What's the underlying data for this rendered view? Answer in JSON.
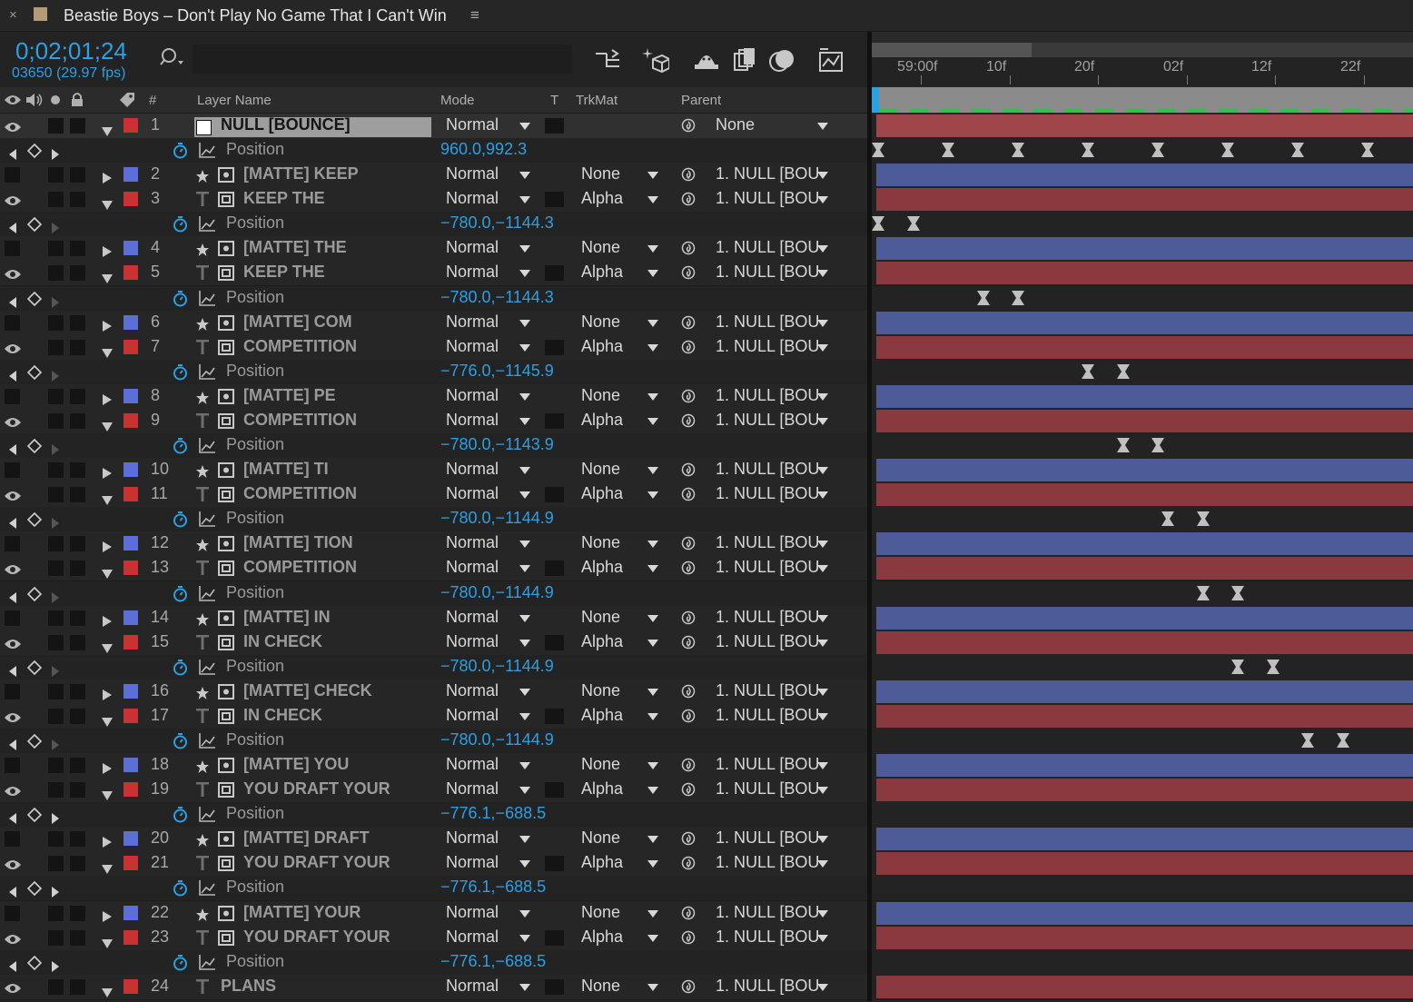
{
  "window": {
    "title": "Beastie Boys – Don't Play No Game That I Can't Win",
    "menu_icon": "≡",
    "close_icon": "×"
  },
  "toolbar": {
    "timecode": "0;02;01;24",
    "frames": "03650 (29.97 fps)"
  },
  "columns": {
    "layer_name": "Layer Name",
    "number": "#",
    "mode": "Mode",
    "t": "T",
    "trkmat": "TrkMat",
    "parent": "Parent"
  },
  "ruler": {
    "labels": [
      "59:00f",
      "10f",
      "20f",
      "02f",
      "12f",
      "22f"
    ]
  },
  "colors": {
    "accent": "#2d9fe3",
    "red_label": "#c83232",
    "blue_label": "#5c6fd6",
    "red_bar": "#8a3a3e",
    "blue_bar": "#4e5b99",
    "null_bar": "#a0464b",
    "marker_green": "#2ec24a"
  },
  "rows": [
    {
      "kind": "layer",
      "num": "1",
      "name": "NULL [BOUNCE]",
      "type": "null",
      "label": "red",
      "mode": "Normal",
      "trkmat": "",
      "parent": "None",
      "eye": true,
      "twirl": "down",
      "selected": true
    },
    {
      "kind": "prop",
      "name": "Position",
      "value": "960.0,992.3",
      "keys": true,
      "kfs": [
        0,
        14,
        28,
        42,
        56,
        70,
        84,
        98
      ]
    },
    {
      "kind": "layer",
      "num": "2",
      "name": "[MATTE] KEEP",
      "type": "shape",
      "label": "blue",
      "mode": "Normal",
      "trkmat": "None",
      "parent": "1. NULL [BOU",
      "eye": false,
      "twirl": "right"
    },
    {
      "kind": "layer",
      "num": "3",
      "name": "KEEP THE",
      "type": "text",
      "label": "red",
      "mode": "Normal",
      "trkmat": "Alpha",
      "parent": "1. NULL [BOU",
      "eye": true,
      "twirl": "down"
    },
    {
      "kind": "prop",
      "name": "Position",
      "value": "−780.0,−1144.3",
      "keys": false,
      "kfs": [
        0,
        7
      ]
    },
    {
      "kind": "layer",
      "num": "4",
      "name": "[MATTE] THE",
      "type": "shape",
      "label": "blue",
      "mode": "Normal",
      "trkmat": "None",
      "parent": "1. NULL [BOU",
      "eye": false,
      "twirl": "right"
    },
    {
      "kind": "layer",
      "num": "5",
      "name": "KEEP THE",
      "type": "text",
      "label": "red",
      "mode": "Normal",
      "trkmat": "Alpha",
      "parent": "1. NULL [BOU",
      "eye": true,
      "twirl": "down"
    },
    {
      "kind": "prop",
      "name": "Position",
      "value": "−780.0,−1144.3",
      "keys": false,
      "kfs": [
        21,
        28
      ]
    },
    {
      "kind": "layer",
      "num": "6",
      "name": "[MATTE] COM",
      "type": "shape",
      "label": "blue",
      "mode": "Normal",
      "trkmat": "None",
      "parent": "1. NULL [BOU",
      "eye": false,
      "twirl": "right"
    },
    {
      "kind": "layer",
      "num": "7",
      "name": "COMPETITION",
      "type": "text",
      "label": "red",
      "mode": "Normal",
      "trkmat": "Alpha",
      "parent": "1. NULL [BOU",
      "eye": true,
      "twirl": "down"
    },
    {
      "kind": "prop",
      "name": "Position",
      "value": "−776.0,−1145.9",
      "keys": false,
      "kfs": [
        42,
        49
      ]
    },
    {
      "kind": "layer",
      "num": "8",
      "name": "[MATTE] PE",
      "type": "shape",
      "label": "blue",
      "mode": "Normal",
      "trkmat": "None",
      "parent": "1. NULL [BOU",
      "eye": false,
      "twirl": "right"
    },
    {
      "kind": "layer",
      "num": "9",
      "name": "COMPETITION",
      "type": "text",
      "label": "red",
      "mode": "Normal",
      "trkmat": "Alpha",
      "parent": "1. NULL [BOU",
      "eye": true,
      "twirl": "down"
    },
    {
      "kind": "prop",
      "name": "Position",
      "value": "−780.0,−1143.9",
      "keys": false,
      "kfs": [
        49,
        56
      ]
    },
    {
      "kind": "layer",
      "num": "10",
      "name": "[MATTE] TI",
      "type": "shape",
      "label": "blue",
      "mode": "Normal",
      "trkmat": "None",
      "parent": "1. NULL [BOU",
      "eye": false,
      "twirl": "right"
    },
    {
      "kind": "layer",
      "num": "11",
      "name": "COMPETITION",
      "type": "text",
      "label": "red",
      "mode": "Normal",
      "trkmat": "Alpha",
      "parent": "1. NULL [BOU",
      "eye": true,
      "twirl": "down"
    },
    {
      "kind": "prop",
      "name": "Position",
      "value": "−780.0,−1144.9",
      "keys": false,
      "kfs": [
        58,
        65
      ]
    },
    {
      "kind": "layer",
      "num": "12",
      "name": "[MATTE] TION",
      "type": "shape",
      "label": "blue",
      "mode": "Normal",
      "trkmat": "None",
      "parent": "1. NULL [BOU",
      "eye": false,
      "twirl": "right"
    },
    {
      "kind": "layer",
      "num": "13",
      "name": "COMPETITION",
      "type": "text",
      "label": "red",
      "mode": "Normal",
      "trkmat": "Alpha",
      "parent": "1. NULL [BOU",
      "eye": true,
      "twirl": "down"
    },
    {
      "kind": "prop",
      "name": "Position",
      "value": "−780.0,−1144.9",
      "keys": false,
      "kfs": [
        65,
        72
      ]
    },
    {
      "kind": "layer",
      "num": "14",
      "name": "[MATTE] IN",
      "type": "shape",
      "label": "blue",
      "mode": "Normal",
      "trkmat": "None",
      "parent": "1. NULL [BOU",
      "eye": false,
      "twirl": "right"
    },
    {
      "kind": "layer",
      "num": "15",
      "name": "IN CHECK",
      "type": "text",
      "label": "red",
      "mode": "Normal",
      "trkmat": "Alpha",
      "parent": "1. NULL [BOU",
      "eye": true,
      "twirl": "down"
    },
    {
      "kind": "prop",
      "name": "Position",
      "value": "−780.0,−1144.9",
      "keys": false,
      "kfs": [
        72,
        79
      ]
    },
    {
      "kind": "layer",
      "num": "16",
      "name": "[MATTE] CHECK",
      "type": "shape",
      "label": "blue",
      "mode": "Normal",
      "trkmat": "None",
      "parent": "1. NULL [BOU",
      "eye": false,
      "twirl": "right"
    },
    {
      "kind": "layer",
      "num": "17",
      "name": "IN CHECK",
      "type": "text",
      "label": "red",
      "mode": "Normal",
      "trkmat": "Alpha",
      "parent": "1. NULL [BOU",
      "eye": true,
      "twirl": "down"
    },
    {
      "kind": "prop",
      "name": "Position",
      "value": "−780.0,−1144.9",
      "keys": false,
      "kfs": [
        86,
        93
      ]
    },
    {
      "kind": "layer",
      "num": "18",
      "name": "[MATTE] YOU",
      "type": "shape",
      "label": "blue",
      "mode": "Normal",
      "trkmat": "None",
      "parent": "1. NULL [BOU",
      "eye": false,
      "twirl": "right"
    },
    {
      "kind": "layer",
      "num": "19",
      "name": "YOU DRAFT YOUR",
      "type": "text",
      "label": "red",
      "mode": "Normal",
      "trkmat": "Alpha",
      "parent": "1. NULL [BOU",
      "eye": true,
      "twirl": "down"
    },
    {
      "kind": "prop",
      "name": "Position",
      "value": "−776.1,−688.5",
      "keys": true,
      "kfs": []
    },
    {
      "kind": "layer",
      "num": "20",
      "name": "[MATTE] DRAFT",
      "type": "shape",
      "label": "blue",
      "mode": "Normal",
      "trkmat": "None",
      "parent": "1. NULL [BOU",
      "eye": false,
      "twirl": "right"
    },
    {
      "kind": "layer",
      "num": "21",
      "name": "YOU DRAFT YOUR",
      "type": "text",
      "label": "red",
      "mode": "Normal",
      "trkmat": "Alpha",
      "parent": "1. NULL [BOU",
      "eye": true,
      "twirl": "down"
    },
    {
      "kind": "prop",
      "name": "Position",
      "value": "−776.1,−688.5",
      "keys": true,
      "kfs": []
    },
    {
      "kind": "layer",
      "num": "22",
      "name": "[MATTE] YOUR",
      "type": "shape",
      "label": "blue",
      "mode": "Normal",
      "trkmat": "None",
      "parent": "1. NULL [BOU",
      "eye": false,
      "twirl": "right"
    },
    {
      "kind": "layer",
      "num": "23",
      "name": "YOU DRAFT YOUR",
      "type": "text",
      "label": "red",
      "mode": "Normal",
      "trkmat": "Alpha",
      "parent": "1. NULL [BOU",
      "eye": true,
      "twirl": "down"
    },
    {
      "kind": "prop",
      "name": "Position",
      "value": "−776.1,−688.5",
      "keys": true,
      "kfs": []
    },
    {
      "kind": "layer",
      "num": "24",
      "name": "PLANS",
      "type": "text",
      "label": "red",
      "mode": "Normal",
      "trkmat": "None",
      "parent": "1. NULL [BOU",
      "eye": true,
      "twirl": "down",
      "plain": true
    }
  ]
}
